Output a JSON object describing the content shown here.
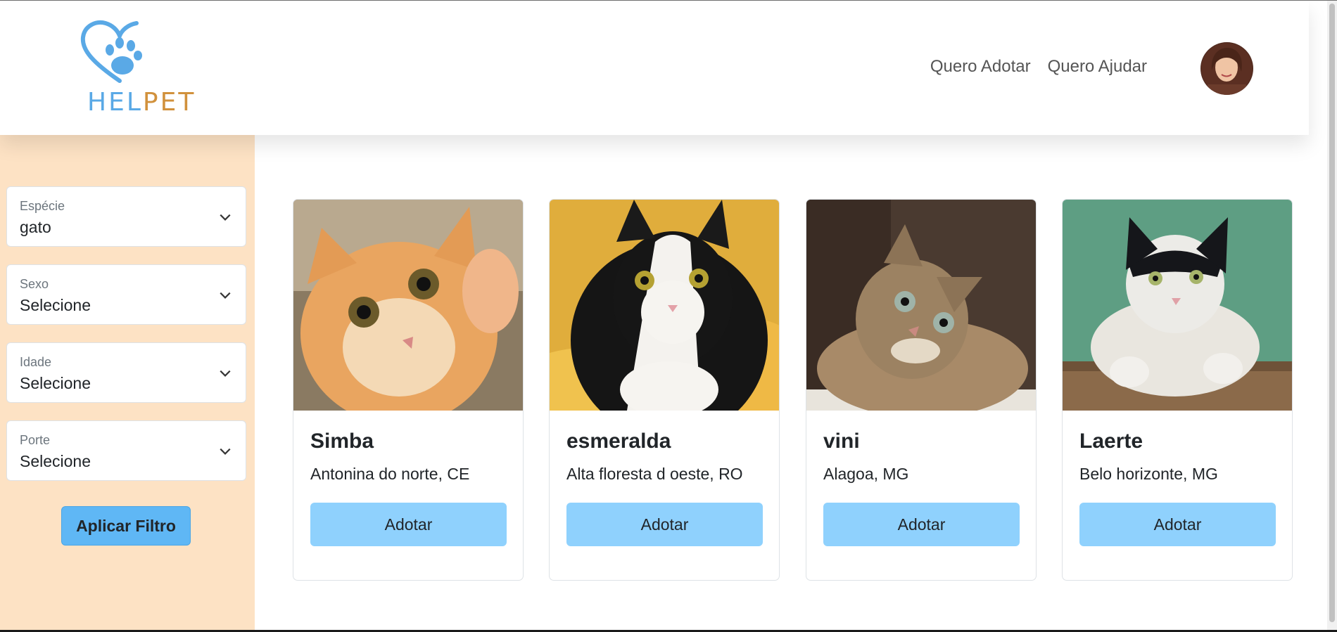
{
  "brand": {
    "logo_part1": "HEL",
    "logo_part2": "PET"
  },
  "nav": {
    "adopt_label": "Quero Adotar",
    "help_label": "Quero Ajudar"
  },
  "filters": [
    {
      "label": "Espécie",
      "value": "gato"
    },
    {
      "label": "Sexo",
      "value": "Selecione"
    },
    {
      "label": "Idade",
      "value": "Selecione"
    },
    {
      "label": "Porte",
      "value": "Selecione"
    }
  ],
  "apply_label": "Aplicar Filtro",
  "pets": [
    {
      "name": "Simba",
      "location": "Antonina do norte, CE",
      "button": "Adotar",
      "icon": "orange-tabby-cat-photo"
    },
    {
      "name": "esmeralda",
      "location": "Alta floresta d oeste, RO",
      "button": "Adotar",
      "icon": "black-white-cat-photo"
    },
    {
      "name": "vini",
      "location": "Alagoa, MG",
      "button": "Adotar",
      "icon": "tabby-cat-photo"
    },
    {
      "name": "Laerte",
      "location": "Belo horizonte, MG",
      "button": "Adotar",
      "icon": "black-white-cat-green-photo"
    }
  ],
  "colors": {
    "sidebar_bg": "#fde2c4",
    "apply_button": "#5fb7f5",
    "adopt_button": "#8fd1fd",
    "logo_blue": "#5aa9e6",
    "logo_orange": "#d1913c"
  }
}
